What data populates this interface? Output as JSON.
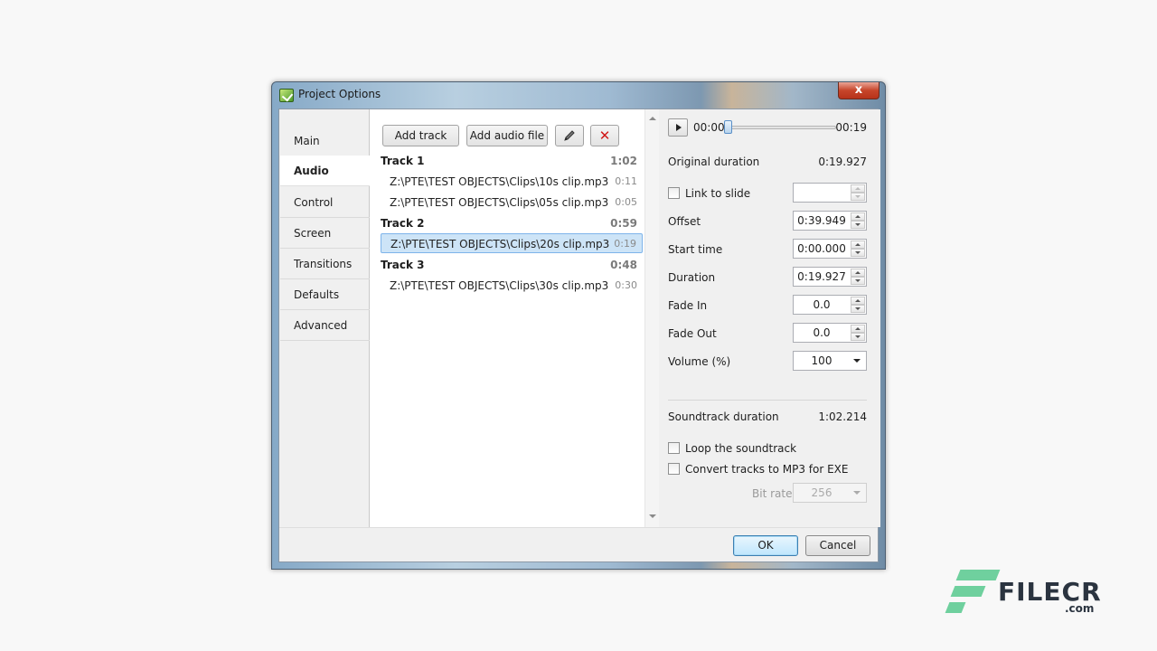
{
  "window": {
    "title": "Project Options",
    "close_glyph": "x"
  },
  "nav": {
    "items": [
      {
        "label": "Main"
      },
      {
        "label": "Audio"
      },
      {
        "label": "Control"
      },
      {
        "label": "Screen"
      },
      {
        "label": "Transitions"
      },
      {
        "label": "Defaults"
      },
      {
        "label": "Advanced"
      }
    ],
    "active": "Audio"
  },
  "toolbar": {
    "add_track_label": "Add track",
    "add_audio_file_label": "Add audio file",
    "edit_icon": "pencil-icon",
    "delete_icon": "red-x-icon",
    "delete_glyph": "✕"
  },
  "tracks": [
    {
      "name": "Track 1",
      "duration": "1:02",
      "clips": [
        {
          "path": "Z:\\PTE\\TEST OBJECTS\\Clips\\10s clip.mp3",
          "duration": "0:11"
        },
        {
          "path": "Z:\\PTE\\TEST OBJECTS\\Clips\\05s clip.mp3",
          "duration": "0:05"
        }
      ]
    },
    {
      "name": "Track 2",
      "duration": "0:59",
      "clips": [
        {
          "path": "Z:\\PTE\\TEST OBJECTS\\Clips\\20s clip.mp3",
          "duration": "0:19",
          "selected": true
        }
      ]
    },
    {
      "name": "Track 3",
      "duration": "0:48",
      "clips": [
        {
          "path": "Z:\\PTE\\TEST OBJECTS\\Clips\\30s clip.mp3",
          "duration": "0:30"
        }
      ]
    }
  ],
  "player": {
    "current_time": "00:00",
    "total_time": "00:19",
    "position_fraction": 0
  },
  "props": {
    "original_duration_label": "Original duration",
    "original_duration_value": "0:19.927",
    "link_to_slide_label": "Link to slide",
    "link_to_slide_value": "",
    "offset_label": "Offset",
    "offset_value": "0:39.949",
    "start_time_label": "Start time",
    "start_time_value": "0:00.000",
    "duration_label": "Duration",
    "duration_value": "0:19.927",
    "fade_in_label": "Fade In",
    "fade_in_value": "0.0",
    "fade_out_label": "Fade Out",
    "fade_out_value": "0.0",
    "volume_label": "Volume (%)",
    "volume_value": "100",
    "soundtrack_duration_label": "Soundtrack duration",
    "soundtrack_duration_value": "1:02.214",
    "loop_label": "Loop the soundtrack",
    "convert_label": "Convert tracks to MP3 for EXE",
    "bitrate_label": "Bit rate",
    "bitrate_value": "256"
  },
  "footer": {
    "ok_label": "OK",
    "cancel_label": "Cancel"
  },
  "watermark": {
    "text": "FILECR",
    "sub": ".com",
    "color": "#6fd09e"
  }
}
